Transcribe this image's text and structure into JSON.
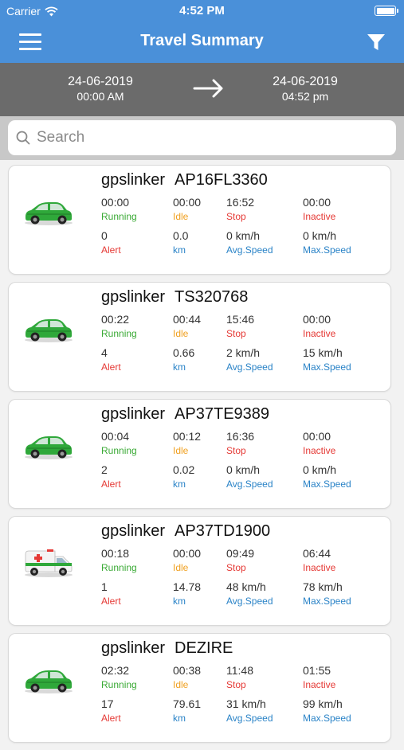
{
  "status_bar": {
    "carrier": "Carrier",
    "time": "4:52 PM"
  },
  "nav": {
    "title": "Travel Summary"
  },
  "date_range": {
    "from_date": "24-06-2019",
    "from_time": "00:00 AM",
    "to_date": "24-06-2019",
    "to_time": "04:52 pm"
  },
  "search": {
    "placeholder": "Search"
  },
  "labels": {
    "running": "Running",
    "idle": "Idle",
    "stop": "Stop",
    "inactive": "Inactive",
    "alert": "Alert",
    "km": "km",
    "avg_speed": "Avg.Speed",
    "max_speed": "Max.Speed"
  },
  "vehicles": [
    {
      "owner": "gpslinker",
      "plate": "AP16FL3360",
      "icon": "green-car-icon",
      "running": "00:00",
      "idle": "00:00",
      "stop": "16:52",
      "inactive": "00:00",
      "alert": "0",
      "km": "0.0",
      "avg_speed": "0 km/h",
      "max_speed": "0 km/h"
    },
    {
      "owner": "gpslinker",
      "plate": "TS320768",
      "icon": "green-car-icon",
      "running": "00:22",
      "idle": "00:44",
      "stop": "15:46",
      "inactive": "00:00",
      "alert": "4",
      "km": "0.66",
      "avg_speed": "2 km/h",
      "max_speed": "15 km/h"
    },
    {
      "owner": "gpslinker",
      "plate": "AP37TE9389",
      "icon": "green-car-icon",
      "running": "00:04",
      "idle": "00:12",
      "stop": "16:36",
      "inactive": "00:00",
      "alert": "2",
      "km": "0.02",
      "avg_speed": "0 km/h",
      "max_speed": "0 km/h"
    },
    {
      "owner": "gpslinker",
      "plate": "AP37TD1900",
      "icon": "ambulance-icon",
      "running": "00:18",
      "idle": "00:00",
      "stop": "09:49",
      "inactive": "06:44",
      "alert": "1",
      "km": "14.78",
      "avg_speed": "48 km/h",
      "max_speed": "78 km/h"
    },
    {
      "owner": "gpslinker",
      "plate": "DEZIRE",
      "icon": "green-car-icon",
      "running": "02:32",
      "idle": "00:38",
      "stop": "11:48",
      "inactive": "01:55",
      "alert": "17",
      "km": "79.61",
      "avg_speed": "31 km/h",
      "max_speed": "99 km/h"
    }
  ],
  "colors": {
    "header": "#4a90d9",
    "date_bar": "#6b6b6b",
    "running": "#3aaa35",
    "idle": "#f0a020",
    "stop": "#e53935",
    "info": "#2a83c7"
  }
}
